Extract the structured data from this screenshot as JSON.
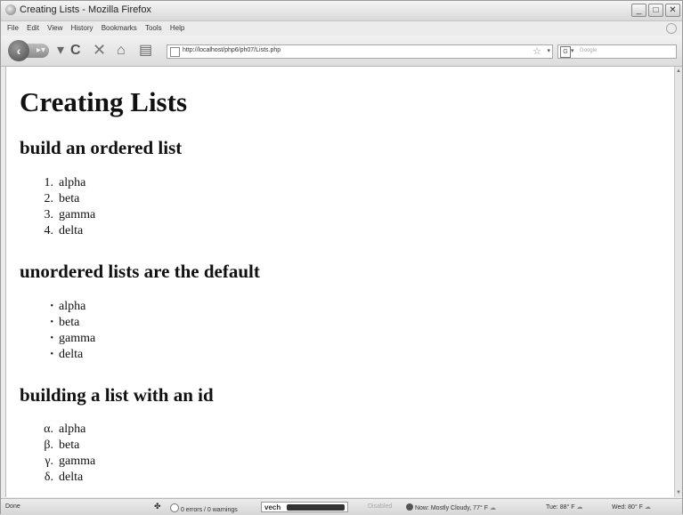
{
  "window": {
    "title": "Creating Lists - Mozilla Firefox",
    "controls": [
      "_",
      "□",
      "✕"
    ]
  },
  "menu": [
    "File",
    "Edit",
    "View",
    "History",
    "Bookmarks",
    "Tools",
    "Help"
  ],
  "navbar": {
    "url": "http://localhost/php6/ph07/Lists.php",
    "search_placeholder": "Google",
    "search_engine": "G"
  },
  "page": {
    "h1": "Creating Lists",
    "sections": [
      {
        "heading": "build an ordered list",
        "markers": [
          "1.",
          "2.",
          "3.",
          "4."
        ],
        "items": [
          "alpha",
          "beta",
          "gamma",
          "delta"
        ]
      },
      {
        "heading": "unordered lists are the default",
        "markers": [
          "•",
          "•",
          "•",
          "•"
        ],
        "items": [
          "alpha",
          "beta",
          "gamma",
          "delta"
        ]
      },
      {
        "heading": "building a list with an id",
        "markers": [
          "α.",
          "β.",
          "γ.",
          "δ."
        ],
        "items": [
          "alpha",
          "beta",
          "gamma",
          "delta"
        ]
      }
    ]
  },
  "status": {
    "left": "Done",
    "validator": "0 errors / 0 warnings",
    "vech": "vech",
    "disabled": "Disabled",
    "weather_now": "Now: Mostly Cloudy, 77° F",
    "weather_tue": "Tue: 88° F",
    "weather_wed": "Wed: 80° F"
  },
  "colors": {
    "chrome_bg": "#ececec",
    "page_bg": "#ffffff",
    "text": "#111111"
  }
}
